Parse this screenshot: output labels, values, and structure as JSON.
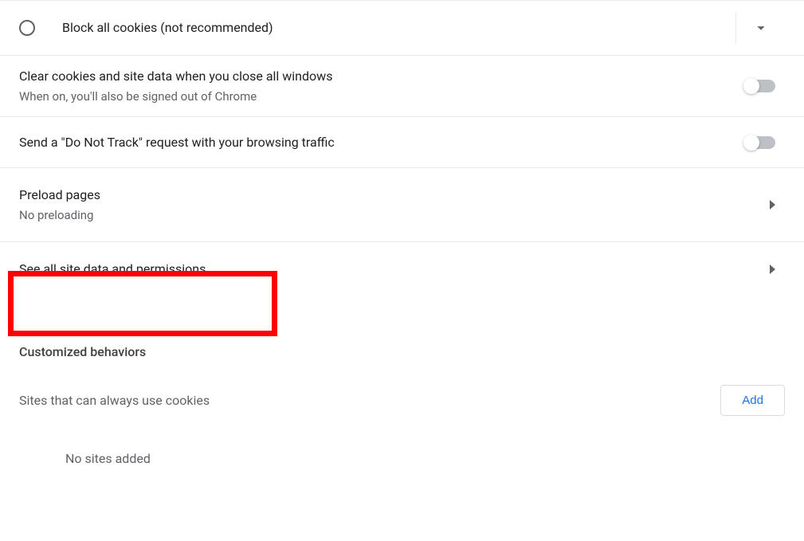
{
  "block_all_cookies": {
    "label": "Block all cookies (not recommended)"
  },
  "clear_on_close": {
    "title": "Clear cookies and site data when you close all windows",
    "subtitle": "When on, you'll also be signed out of Chrome"
  },
  "do_not_track": {
    "title": "Send a \"Do Not Track\" request with your browsing traffic"
  },
  "preload": {
    "title": "Preload pages",
    "subtitle": "No preloading"
  },
  "see_all_site_data": {
    "title": "See all site data and permissions"
  },
  "customized_behaviors_heading": "Customized behaviors",
  "sites_always_cookies": {
    "label": "Sites that can always use cookies",
    "add_button": "Add",
    "empty": "No sites added"
  }
}
